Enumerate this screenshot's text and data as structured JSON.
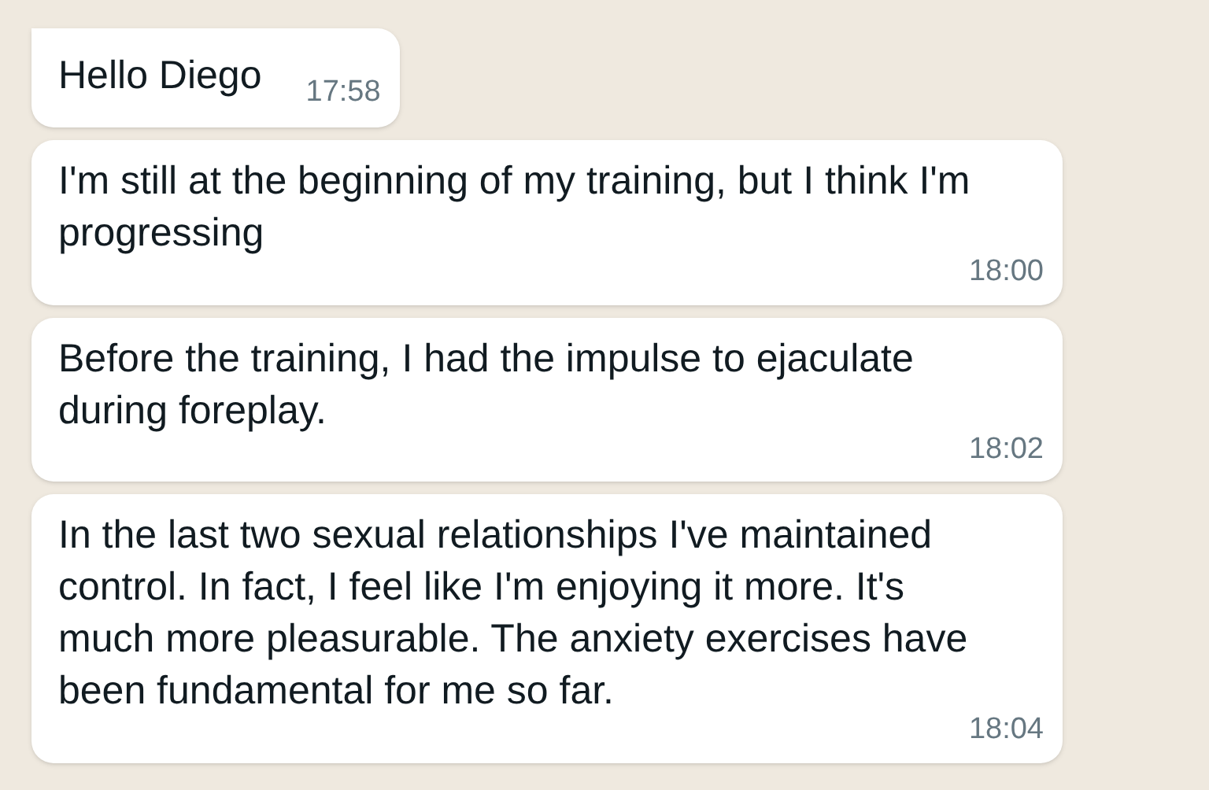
{
  "messages": [
    {
      "text": "Hello Diego",
      "time": "17:58"
    },
    {
      "text": "I'm still at the beginning of my training, but I think I'm progressing",
      "time": "18:00"
    },
    {
      "text": "Before the training, I had the impulse to ejaculate during foreplay.",
      "time": "18:02"
    },
    {
      "text": "In the last two sexual relationships I've maintained control. In fact, I feel like I'm enjoying it more. It's much more pleasurable. The anxiety exercises have been fundamental for me so far.",
      "time": "18:04"
    }
  ]
}
